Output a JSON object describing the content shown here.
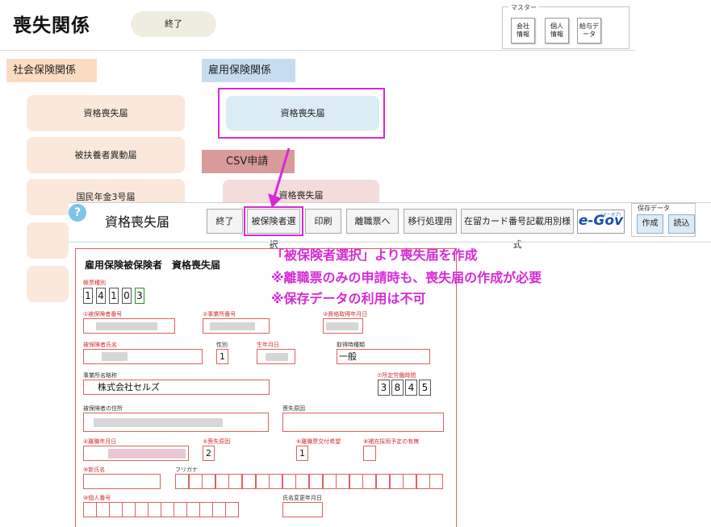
{
  "background": {
    "page_title": "喪失関係",
    "end_button": "終了",
    "master": {
      "legend": "マスター",
      "company_info": "会社情報",
      "person_info": "個人情報",
      "salary_data": "給与データ"
    },
    "social_insurance": {
      "heading": "社会保険関係",
      "tiles": [
        "資格喪失届",
        "被扶養者異動届",
        "国民年金3号届"
      ]
    },
    "employment_insurance": {
      "heading": "雇用保険関係",
      "tile": "資格喪失届"
    },
    "csv": {
      "heading": "CSV申請",
      "tile": "資格喪失届"
    }
  },
  "dialog": {
    "help_glyph": "?",
    "title": "資格喪失届",
    "toolbar": {
      "end": "終了",
      "select_insured": "被保険者選択",
      "print": "印刷",
      "separation_slip": "離職票へ",
      "migration": "移行処理用",
      "residence_card": "在留カード番号記載用別様式"
    },
    "egov": {
      "label": "e-Gov",
      "sub": "(イーガブ)"
    },
    "saved_data": {
      "label": "保存データ",
      "create": "作成",
      "load": "読込"
    }
  },
  "form": {
    "title": "雇用保険被保険者　資格喪失届",
    "form_type_label": "帳票種別",
    "form_type_digits": [
      "1",
      "4",
      "1",
      "0",
      "3"
    ],
    "labels": {
      "insured_number": "①被保険者番号",
      "office_number": "②事業所番号",
      "acquisition_date": "③資格取得年月日",
      "insured_name": "被保険者氏名",
      "gender": "性別",
      "birth_date": "生年月日",
      "acquisition_type": "取得時種類",
      "office_name": "事業所名略称",
      "work_hours": "⑦所定労働時間",
      "insured_address": "被保険者の住所",
      "loss_reason": "喪失原因",
      "separation_date": "④離職年月日",
      "loss_cause": "⑤喪失原因",
      "separation_slip_hope": "⑥離職票交付希望",
      "continued_employment": "⑧補充採用予定の有無",
      "new_name": "⑨新氏名",
      "furigana": "フリガナ",
      "personal_number": "⑩個人番号",
      "name_change_date": "氏名変更年月日"
    },
    "values": {
      "gender": "1",
      "acquisition_type": "一般",
      "office_name": "株式会社セルズ",
      "work_hours_digits": [
        "3",
        "8",
        "4",
        "5"
      ],
      "loss_cause": "2",
      "separation_slip_hope": "1"
    }
  },
  "annotations": {
    "lines": [
      "「被保険者選択」より喪失届を作成",
      "※離職票のみの申請時も、喪失届の作成が必要",
      "※保存データの利用は不可"
    ]
  },
  "colors": {
    "annotation": "#d62ad6",
    "form_red": "#e06060",
    "social_tile": "#fbe8da",
    "employment_tile": "#dcecf4",
    "csv_tile": "#f5dcdc"
  }
}
